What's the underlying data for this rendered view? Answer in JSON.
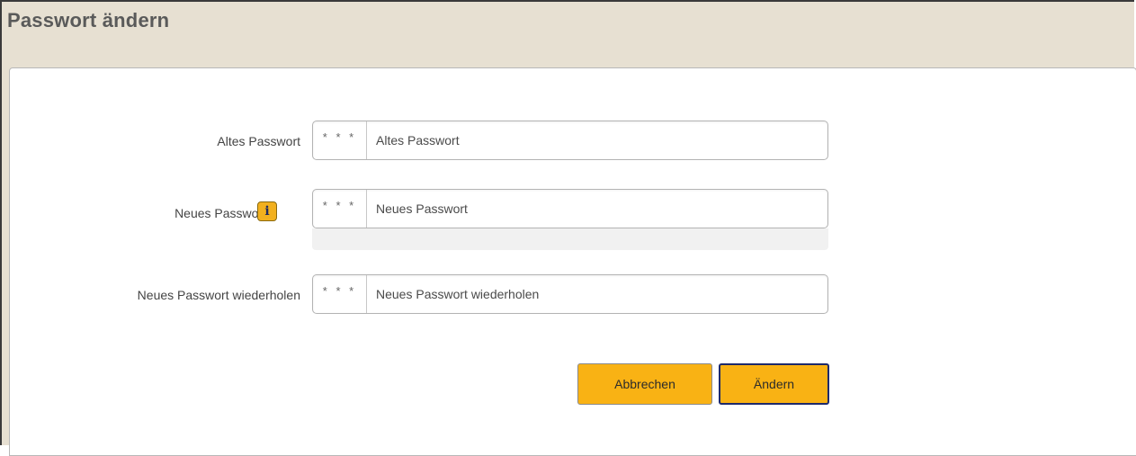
{
  "dialog": {
    "title": "Passwort ändern"
  },
  "form": {
    "old_password": {
      "label": "Altes Passwort",
      "addon": "* * *",
      "placeholder": "Altes Passwort",
      "value": ""
    },
    "new_password": {
      "label": "Neues Passwort",
      "addon": "* * *",
      "placeholder": "Neues Passwort",
      "value": "",
      "info_icon": "i"
    },
    "repeat_password": {
      "label": "Neues Passwort wiederholen",
      "addon": "* * *",
      "placeholder": "Neues Passwort wiederholen",
      "value": ""
    }
  },
  "actions": {
    "cancel_label": "Abbrechen",
    "submit_label": "Ändern"
  },
  "colors": {
    "header_background": "#e7e0d2",
    "button_background": "#f9b214",
    "submit_border": "#1e2a6b",
    "info_icon_background": "#f2b01e"
  }
}
